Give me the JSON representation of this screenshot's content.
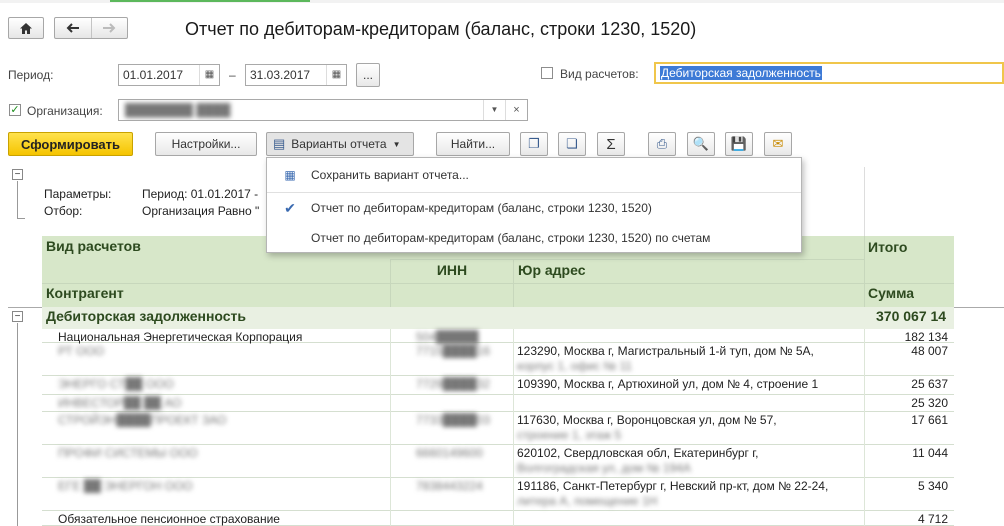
{
  "window": {
    "title": "Отчет по дебиторам-кредиторам (баланс, строки 1230, 1520)"
  },
  "nav": {
    "home_icon": "home-icon",
    "back_icon": "arrow-left-icon",
    "forward_icon": "arrow-right-icon"
  },
  "filters": {
    "period_label": "Период:",
    "date_from": "01.01.2017",
    "dash": "–",
    "date_to": "31.03.2017",
    "more_label": "...",
    "settlement_type_label": "Вид расчетов:",
    "settlement_type_value": "Дебиторская задолженность",
    "settlement_type_checked": false,
    "organization_label": "Организация:",
    "organization_checked": true,
    "organization_value": "████████ ████"
  },
  "toolbar": {
    "generate_label": "Сформировать",
    "settings_label": "Настройки...",
    "variants_label": "Варианты отчета",
    "find_label": "Найти...",
    "icons": [
      "copy-report-icon",
      "copy-all-icon",
      "sum-icon",
      "print-icon",
      "preview-icon",
      "save-icon",
      "mail-icon"
    ],
    "sum_glyph": "Σ"
  },
  "variants_menu": {
    "items": [
      {
        "label": "Сохранить вариант отчета...",
        "icon": "save-variant-icon",
        "checked": false
      },
      {
        "label": "Отчет по дебиторам-кредиторам (баланс, строки 1230, 1520)",
        "icon": "checkmark-icon",
        "checked": true
      },
      {
        "label": "Отчет по дебиторам-кредиторам (баланс, строки 1230, 1520)  по счетам",
        "icon": "",
        "checked": false
      }
    ]
  },
  "report": {
    "params_label": "Параметры:",
    "params_value": "Период: 01.01.2017 -",
    "filter_label": "Отбор:",
    "filter_value": "Организация Равно \"",
    "columns": {
      "settlement_type": "Вид расчетов",
      "inn": "ИНН",
      "address": "Юр адрес",
      "total": "Итого",
      "counterparty": "Контрагент",
      "amount": "Сумма"
    },
    "group": {
      "label": "Дебиторская задолженность",
      "total": "370 067 14"
    },
    "rows": [
      {
        "name": "Национальная Энергетическая Корпорация",
        "inn": "504█████",
        "address": "",
        "address2": "",
        "amount": "182 134"
      },
      {
        "name": "РТ ООО",
        "inn": "7715████16",
        "address": "123290, Москва г, Магистральный 1-й туп, дом № 5А,",
        "address2": "корпус 1, офис № 11",
        "amount": "48 007"
      },
      {
        "name": "ЭНЕРГО СТ██ ООО",
        "inn": "7729████32",
        "address": "109390, Москва г, Артюхиной ул, дом № 4, строение 1",
        "address2": "",
        "amount": "25 637"
      },
      {
        "name": "ИНВЕСТОР██ ██ АО",
        "inn": "",
        "address": "",
        "address2": "",
        "amount": "25 320"
      },
      {
        "name": "СТРОЙЭН████ПРОЕКТ ЗАО",
        "inn": "7733████03",
        "address": "117630, Москва г, Воронцовская ул, дом № 57,",
        "address2": "строение 1, этаж 5",
        "amount": "17 661"
      },
      {
        "name": "ПРОФИ СИСТЕМЫ ООО",
        "inn": "6660149600",
        "address": "620102, Свердловская обл, Екатеринбург г,",
        "address2": "Волгоградская ул, дом № 194А",
        "amount": "11 044"
      },
      {
        "name": "ЕГЕ ██ ЭНЕРГОН ООО",
        "inn": "7838443224",
        "address": "191186, Санкт-Петербург г, Невский пр-кт, дом № 22-24,",
        "address2": "литера А, помещение 1Н",
        "amount": "5 340"
      },
      {
        "name": "Обязательное пенсионное страхование",
        "inn": "",
        "address": "",
        "address2": "",
        "amount": "4 712"
      }
    ]
  }
}
